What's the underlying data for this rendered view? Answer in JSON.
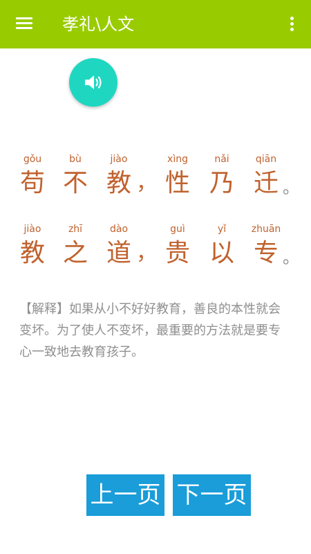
{
  "header": {
    "title": "孝礼\\人文",
    "menu_icon": "hamburger-menu-icon",
    "more_icon": "more-vertical-icon"
  },
  "audio": {
    "icon": "speaker-icon",
    "color": "#1fd7c1"
  },
  "verse": {
    "line1": [
      {
        "pinyin": "gǒu",
        "char": "苟"
      },
      {
        "pinyin": "bù",
        "char": "不"
      },
      {
        "pinyin": "jiào",
        "char": "教"
      },
      {
        "pinyin": "xìng",
        "char": "性"
      },
      {
        "pinyin": "nǎi",
        "char": "乃"
      },
      {
        "pinyin": "qiān",
        "char": "迁"
      }
    ],
    "line2": [
      {
        "pinyin": "jiào",
        "char": "教"
      },
      {
        "pinyin": "zhī",
        "char": "之"
      },
      {
        "pinyin": "dào",
        "char": "道"
      },
      {
        "pinyin": "guì",
        "char": "贵"
      },
      {
        "pinyin": "yǐ",
        "char": "以"
      },
      {
        "pinyin": "zhuān",
        "char": "专"
      }
    ],
    "comma": "，",
    "period": "。",
    "text_color": "#c0622e"
  },
  "explanation": "【解释】如果从小不好好教育，善良的本性就会变坏。为了使人不变坏，最重要的方法就是要专心一致地去教育孩子。",
  "nav": {
    "prev_label": "上一页",
    "next_label": "下一页",
    "button_color": "#1a9dd9"
  },
  "colors": {
    "header_bg": "#99cc00",
    "explanation_text": "#8f8f8f"
  }
}
